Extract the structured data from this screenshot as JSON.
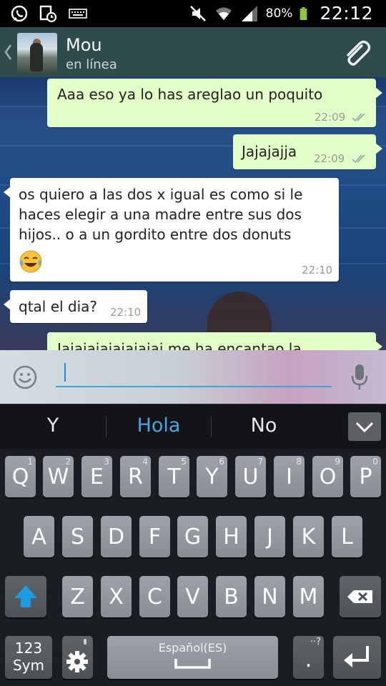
{
  "status_bar": {
    "battery": "80%",
    "time": "22:12",
    "icons": [
      "whatsapp-icon",
      "notification-icon",
      "keyboard-icon",
      "mute-icon",
      "wifi-icon",
      "signal-icon",
      "battery-icon"
    ]
  },
  "header": {
    "contact_name": "Mou",
    "contact_status": "en línea",
    "icons": [
      "back-chevron-icon",
      "avatar",
      "paperclip-icon"
    ]
  },
  "messages": [
    {
      "direction": "out",
      "text": "Aaa eso ya lo has areglao un poquito",
      "time": "22:09",
      "read_ticks": true
    },
    {
      "direction": "out",
      "text": "Jajajajja",
      "time": "22:09",
      "read_ticks": true
    },
    {
      "direction": "in",
      "text_lines": [
        "os quiero a las dos x igual es como si le",
        "haces elegir a una madre entre sus dos",
        "hijos.. o a un gordito entre dos donuts"
      ],
      "emoji": "laughing-tears-emoji",
      "time": "22:10"
    },
    {
      "direction": "in",
      "text": "qtal el dia?",
      "time": "22:10"
    },
    {
      "direction": "out",
      "text": "Jajajajajajajajaj me ha encantao la",
      "time": ""
    }
  ],
  "composer": {
    "value": "",
    "icons": [
      "emoji-icon",
      "microphone-icon"
    ]
  },
  "suggestions": {
    "items": [
      "Y",
      "Hola",
      "No"
    ],
    "active_index": 1,
    "accent": "#4aa7e0"
  },
  "keyboard": {
    "row1": [
      [
        "Q",
        "1"
      ],
      [
        "W",
        "2"
      ],
      [
        "E",
        "3"
      ],
      [
        "R",
        "4"
      ],
      [
        "T",
        "5"
      ],
      [
        "Y",
        "6"
      ],
      [
        "U",
        "7"
      ],
      [
        "I",
        "8"
      ],
      [
        "O",
        "9"
      ],
      [
        "P",
        "0"
      ]
    ],
    "row2": [
      "A",
      "S",
      "D",
      "F",
      "G",
      "H",
      "J",
      "K",
      "L"
    ],
    "row3": [
      "Z",
      "X",
      "C",
      "V",
      "B",
      "N",
      "M"
    ],
    "sym_key_line1": "123",
    "sym_key_line2": "Sym",
    "space_label": "Español(ES)",
    "period_key": ".",
    "period_key_alt": "··?",
    "icons": [
      "shift-icon",
      "backspace-icon",
      "settings-gear-icon",
      "enter-icon",
      "space-bar-icon",
      "collapse-chevron-icon"
    ]
  },
  "colors": {
    "header_bg": "#2f4b4b",
    "outgoing_bubble": "#e2ffc7",
    "incoming_bubble": "#ffffff",
    "accent_blue": "#4aa7e0",
    "shift_blue": "#1e9ae0"
  }
}
